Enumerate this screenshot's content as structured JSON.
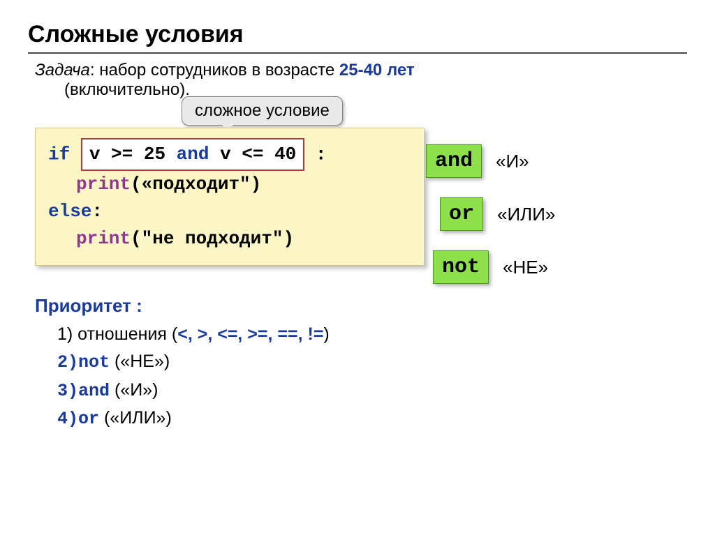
{
  "title": "Сложные условия",
  "task": {
    "label": "Задача",
    "text": ": набор сотрудников в возрасте ",
    "highlight": "25-40 лет",
    "sub": "(включительно)."
  },
  "callout": "сложное условие",
  "code": {
    "if": "if",
    "cond_v1": "v >= 25 ",
    "cond_and": "and",
    "cond_v2": " v <= 40",
    "colon": " :",
    "print1_fn": "print",
    "print1_args": "(«подходит\")",
    "else": "else",
    "print2_fn": "print",
    "print2_args": "(\"не подходит\")"
  },
  "operators": [
    {
      "badge": "and",
      "desc": "«И»"
    },
    {
      "badge": "or",
      "desc": "«ИЛИ»"
    },
    {
      "badge": "not",
      "desc": "«НЕ»"
    }
  ],
  "priority": {
    "title": "Приоритет :",
    "line1_pre": "1) отношения (",
    "line1_ops": "<, >, <=, >=, ==, !=",
    "line1_post": ")",
    "line2_num": "2)",
    "line2_kw": "not",
    "line2_desc": "(«НЕ»)",
    "line3_num": "3)",
    "line3_kw": "and",
    "line3_desc": "(«И»)",
    "line4_num": "4)",
    "line4_kw": "or",
    "line4_desc": "(«ИЛИ»)"
  }
}
